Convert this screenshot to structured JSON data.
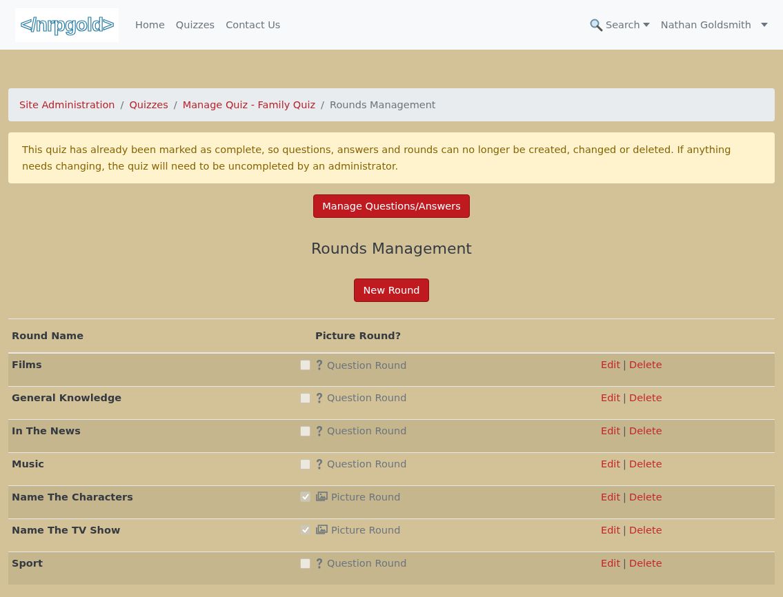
{
  "navbar": {
    "logo": "</nrpgold>",
    "links": [
      "Home",
      "Quizzes",
      "Contact Us"
    ],
    "search": "Search",
    "user": "Nathan Goldsmith"
  },
  "breadcrumb": {
    "items": [
      "Site Administration",
      "Quizzes",
      "Manage Quiz - Family Quiz"
    ],
    "separator": "/",
    "current": "Rounds Management"
  },
  "alert": "This quiz has already been marked as complete, so questions, answers and rounds can no longer be created, changed or deleted. If anything needs changing, the quiz will need to be uncompleted by an administrator.",
  "manage_button": "Manage Questions/Answers",
  "heading": "Rounds Management",
  "new_button": "New Round",
  "table": {
    "columns": [
      "Round Name",
      "Picture Round?"
    ],
    "rows": [
      {
        "name": "Films",
        "checked": false,
        "kind": "question",
        "type_label": "Question Round",
        "edit": "Edit",
        "sep": "|",
        "delete": "Delete"
      },
      {
        "name": "General Knowledge",
        "checked": false,
        "kind": "question",
        "type_label": "Question Round",
        "edit": "Edit",
        "sep": "|",
        "delete": "Delete"
      },
      {
        "name": "In The News",
        "checked": false,
        "kind": "question",
        "type_label": "Question Round",
        "edit": "Edit",
        "sep": "|",
        "delete": "Delete"
      },
      {
        "name": "Music",
        "checked": false,
        "kind": "question",
        "type_label": "Question Round",
        "edit": "Edit",
        "sep": "|",
        "delete": "Delete"
      },
      {
        "name": "Name The Characters",
        "checked": true,
        "kind": "picture",
        "type_label": "Picture Round",
        "edit": "Edit",
        "sep": "|",
        "delete": "Delete"
      },
      {
        "name": "Name The TV Show",
        "checked": true,
        "kind": "picture",
        "type_label": "Picture Round",
        "edit": "Edit",
        "sep": "|",
        "delete": "Delete"
      },
      {
        "name": "Sport",
        "checked": false,
        "kind": "question",
        "type_label": "Question Round",
        "edit": "Edit",
        "sep": "|",
        "delete": "Delete"
      }
    ]
  }
}
